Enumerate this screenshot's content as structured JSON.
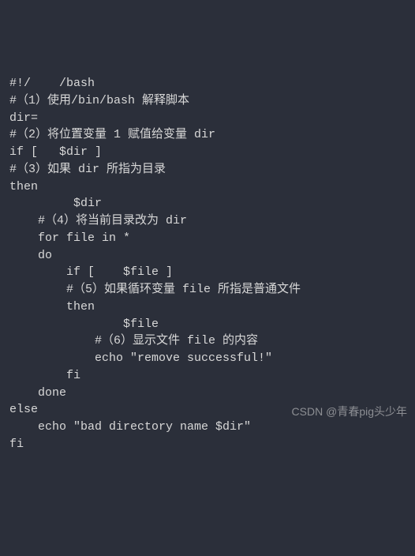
{
  "code": {
    "lines": [
      "#!/    /bash",
      "#（1）使用/bin/bash 解释脚本",
      "dir=",
      "#（2）将位置变量 1 赋值给变量 dir",
      "if [   $dir ]",
      "#（3）如果 dir 所指为目录",
      "then",
      "         $dir",
      "    #（4）将当前目录改为 dir",
      "    for file in *",
      "    do",
      "        if [    $file ]",
      "        #（5）如果循环变量 file 所指是普通文件",
      "        then",
      "                $file",
      "            #（6）显示文件 file 的内容",
      "            echo \"remove successful!\"",
      "        fi",
      "    done",
      "else",
      "    echo \"bad directory name $dir\"",
      "fi"
    ]
  },
  "watermark": "CSDN @青春pig头少年"
}
